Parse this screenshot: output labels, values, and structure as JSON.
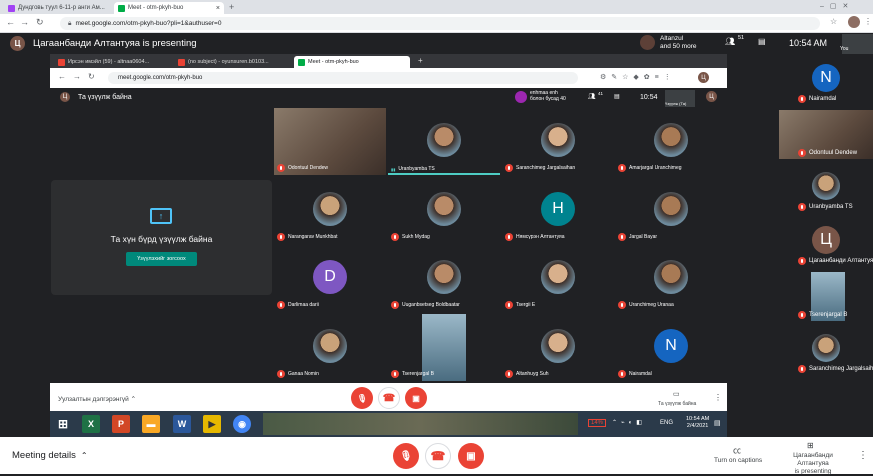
{
  "outer_browser": {
    "tabs": [
      {
        "label": "Дундговь туул 6-11-р анги Ам...",
        "color": "#a142f4"
      },
      {
        "label": "Meet - otm-pkyh-buo",
        "color": "#00ac47"
      }
    ],
    "new_tab": "+",
    "url": "meet.google.com/otm-pkyh-buo?pli=1&authuser=0"
  },
  "meet_top": {
    "presenter_initial": "Ц",
    "presenting_text": "Цагаанбанди Алтантуяа is presenting",
    "others_line1": "Altanzul",
    "others_line2": "and 50 more",
    "people_count": "51",
    "time": "10:54 AM",
    "you_label": "You"
  },
  "inner_browser": {
    "tabs": [
      {
        "label": "Ирсэн имэйл (59) - altnaa0604...",
        "color": "#ea4335"
      },
      {
        "label": "(no subject) - oyunsuren.b0103...",
        "color": "#ea4335"
      },
      {
        "label": "Meet - otm-pkyh-buo",
        "color": "#00ac47"
      }
    ],
    "url": "meet.google.com/otm-pkyh-buo",
    "presenting_label": "Та үзүүлж байна",
    "joined_line1": "enhmaa enh",
    "joined_line2": "болон бусад 40",
    "count": "41",
    "time": "10:54",
    "you_label": "Үзүүлж (Та)",
    "profile_initial": "Ц"
  },
  "presenting_panel": {
    "title": "Та хүн бүрд үзүүлж байна",
    "stop_button": "Үзүүлэхийг зогсоох"
  },
  "grid": [
    {
      "name": "Odontuul Dendew",
      "kind": "video",
      "muted": true
    },
    {
      "name": "Uranbyamba TS",
      "kind": "photo",
      "muted": false,
      "speaking": true
    },
    {
      "name": "Saranchimeg Jargalsaihan",
      "kind": "photo",
      "muted": true
    },
    {
      "name": "Amarjargal Uranchimeg",
      "kind": "photo",
      "muted": true
    },
    {
      "name": "Narangarav Munkhbat",
      "kind": "photo",
      "muted": true
    },
    {
      "name": "Sukh Mydag",
      "kind": "photo",
      "muted": true
    },
    {
      "name": "Нямсүрэн Алтантуяа",
      "kind": "letter",
      "letter": "H",
      "color": "#00838f",
      "muted": true
    },
    {
      "name": "Jargal Bayar",
      "kind": "photo",
      "muted": true
    },
    {
      "name": "Darlimaa darii",
      "kind": "letter",
      "letter": "D",
      "color": "#7e57c2",
      "muted": true
    },
    {
      "name": "Uuganbsetseg Boldbaatar",
      "kind": "photo",
      "muted": true
    },
    {
      "name": "Tsergii E",
      "kind": "photo",
      "muted": true
    },
    {
      "name": "Uranchimeg Uranaa",
      "kind": "photo",
      "muted": true
    },
    {
      "name": "Ganaa Nomin",
      "kind": "photo",
      "muted": true
    },
    {
      "name": "Tserenjargal B",
      "kind": "video",
      "muted": true
    },
    {
      "name": "Altanhuyg Suh",
      "kind": "photo",
      "muted": true
    },
    {
      "name": "Nairamdal",
      "kind": "letter",
      "letter": "N",
      "color": "#1565c0",
      "muted": true
    }
  ],
  "inner_bottom": {
    "meeting_details": "Уулзалтын дэлгэрэнгүй",
    "presenting": "Та үзүүлж байна"
  },
  "taskbar": {
    "battery": "14%",
    "lang": "ENG",
    "time": "10:54 AM",
    "date": "2/4/2021"
  },
  "right_strip": [
    {
      "name": "Nairamdal",
      "kind": "letter",
      "letter": "N",
      "color": "#1565c0"
    },
    {
      "name": "Odontuul Dendew",
      "kind": "video"
    },
    {
      "name": "Uranbyamba TS",
      "kind": "photo"
    },
    {
      "name": "Цагаанбанди Алтантуяа",
      "kind": "letter",
      "letter": "Ц",
      "color": "#795548"
    },
    {
      "name": "Tserenjargal B",
      "kind": "video"
    },
    {
      "name": "Saranchimeg Jargalsaihan",
      "kind": "photo"
    }
  ],
  "meet_bottom": {
    "details": "Meeting details",
    "captions": "Turn on captions",
    "presenter_line1": "Цагаанбанди Алтантуяа",
    "presenter_line2": "is presenting"
  },
  "colors": {
    "red": "#ea4335",
    "meet_bg": "#202124",
    "tile": "#3c4043",
    "teal": "#00897b"
  }
}
